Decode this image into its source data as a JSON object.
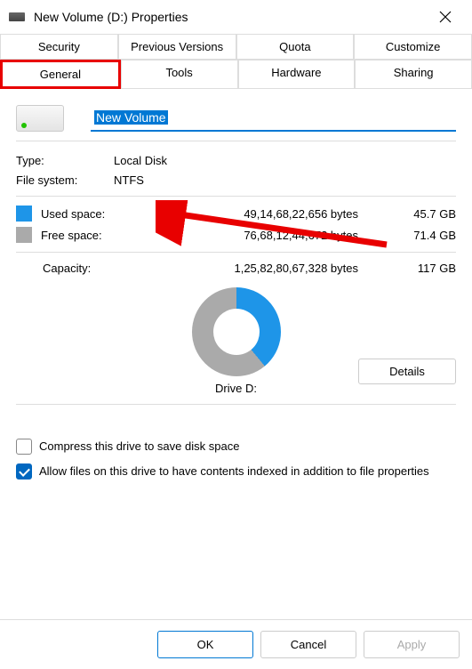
{
  "titlebar": {
    "title": "New Volume (D:) Properties"
  },
  "tabs": {
    "row1": [
      "Security",
      "Previous Versions",
      "Quota",
      "Customize"
    ],
    "row2": [
      "General",
      "Tools",
      "Hardware",
      "Sharing"
    ]
  },
  "volume_name": "New Volume",
  "general": {
    "type_label": "Type:",
    "type_value": "Local Disk",
    "fs_label": "File system:",
    "fs_value": "NTFS",
    "used_label": "Used space:",
    "used_bytes": "49,14,68,22,656 bytes",
    "used_gb": "45.7 GB",
    "free_label": "Free space:",
    "free_bytes": "76,68,12,44,672 bytes",
    "free_gb": "71.4 GB",
    "capacity_label": "Capacity:",
    "capacity_bytes": "1,25,82,80,67,328 bytes",
    "capacity_gb": "117 GB",
    "drive_label": "Drive D:",
    "details_btn": "Details"
  },
  "checks": {
    "compress": {
      "label": "Compress this drive to save disk space",
      "checked": false
    },
    "index": {
      "label": "Allow files on this drive to have contents indexed in addition to file properties",
      "checked": true
    }
  },
  "buttons": {
    "ok": "OK",
    "cancel": "Cancel",
    "apply": "Apply"
  },
  "chart_data": {
    "type": "pie",
    "title": "Drive D:",
    "series": [
      {
        "name": "Used space",
        "value": 45.7,
        "unit": "GB",
        "color": "#1e95e8"
      },
      {
        "name": "Free space",
        "value": 71.4,
        "unit": "GB",
        "color": "#aaaaaa"
      }
    ],
    "total": 117,
    "total_unit": "GB"
  }
}
